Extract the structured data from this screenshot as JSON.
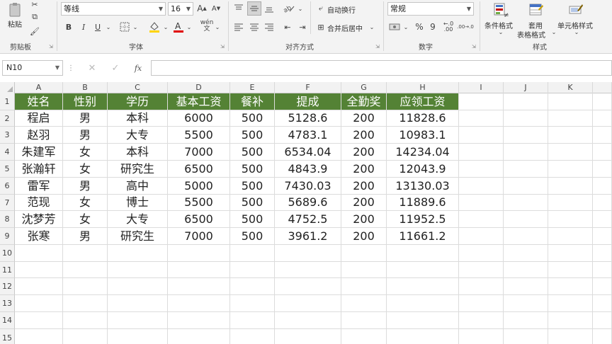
{
  "ribbon": {
    "clipboard": {
      "paste_label": "粘贴",
      "group_label": "剪贴板"
    },
    "font": {
      "font_name": "等线",
      "font_size": "16",
      "bold": "B",
      "italic": "I",
      "underline": "U",
      "phonetic": "wén",
      "group_label": "字体"
    },
    "alignment": {
      "wrap_text": "自动换行",
      "merge_center": "合并后居中",
      "group_label": "对齐方式"
    },
    "number": {
      "format": "常规",
      "percent": "%",
      "comma": "9",
      "dec_inc": ".00→.0",
      "group_label": "数字"
    },
    "styles": {
      "conditional": "条件格式",
      "table_format_1": "套用",
      "table_format_2": "表格格式",
      "cell_styles": "单元格样式",
      "group_label": "样式"
    }
  },
  "formula_bar": {
    "name_box": "N10",
    "fx": "fx",
    "formula": ""
  },
  "sheet": {
    "columns": [
      "A",
      "B",
      "C",
      "D",
      "E",
      "F",
      "G",
      "H",
      "I",
      "J",
      "K"
    ],
    "rows": [
      "1",
      "2",
      "3",
      "4",
      "5",
      "6",
      "7",
      "8",
      "9",
      "10",
      "11",
      "12",
      "13",
      "14",
      "15"
    ],
    "header": [
      "姓名",
      "性别",
      "学历",
      "基本工资",
      "餐补",
      "提成",
      "全勤奖",
      "应领工资"
    ],
    "data": [
      [
        "程启",
        "男",
        "本科",
        "6000",
        "500",
        "5128.6",
        "200",
        "11828.6"
      ],
      [
        "赵羽",
        "男",
        "大专",
        "5500",
        "500",
        "4783.1",
        "200",
        "10983.1"
      ],
      [
        "朱建军",
        "女",
        "本科",
        "7000",
        "500",
        "6534.04",
        "200",
        "14234.04"
      ],
      [
        "张瀚轩",
        "女",
        "研究生",
        "6500",
        "500",
        "4843.9",
        "200",
        "12043.9"
      ],
      [
        "雷军",
        "男",
        "高中",
        "5000",
        "500",
        "7430.03",
        "200",
        "13130.03"
      ],
      [
        "范现",
        "女",
        "博士",
        "5500",
        "500",
        "5689.6",
        "200",
        "11889.6"
      ],
      [
        "沈梦芳",
        "女",
        "大专",
        "6500",
        "500",
        "4752.5",
        "200",
        "11952.5"
      ],
      [
        "张寒",
        "男",
        "研究生",
        "7000",
        "500",
        "3961.2",
        "200",
        "11661.2"
      ]
    ]
  },
  "colors": {
    "header_fill": "#548235",
    "header_text": "#ffffff",
    "font_color_bar": "#e00000",
    "fill_color_bar": "#ffd400"
  }
}
